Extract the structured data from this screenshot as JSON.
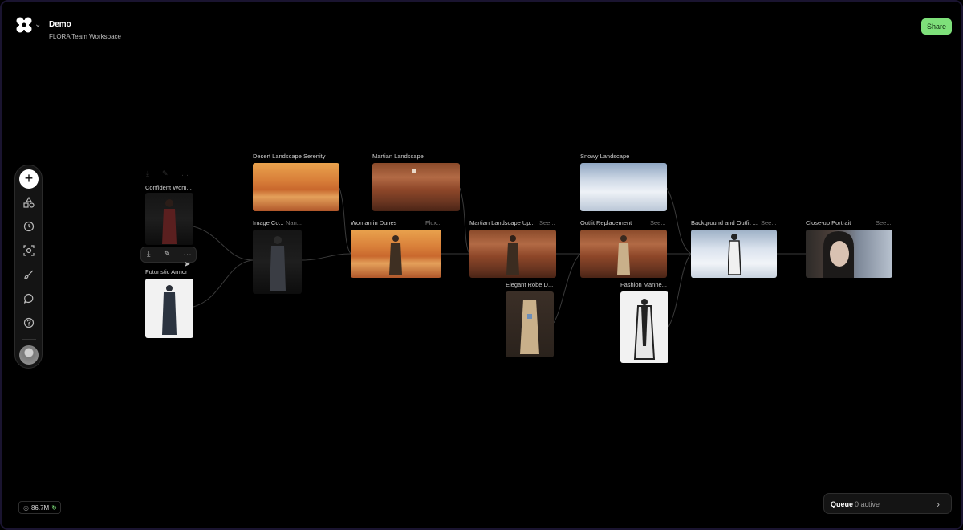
{
  "header": {
    "project_title": "Demo",
    "workspace": "FLORA Team Workspace",
    "share_label": "Share"
  },
  "toolbar": {
    "add_label": "+",
    "icons": [
      "shapes-icon",
      "history-icon",
      "scan-icon",
      "brush-icon",
      "chat-icon",
      "help-icon"
    ]
  },
  "nodes": {
    "confident_woman": {
      "label": "Confident Wom..."
    },
    "futuristic_armor": {
      "label": "Futuristic Armor"
    },
    "desert_landscape": {
      "label": "Desert Landscape Serenity"
    },
    "image_co": {
      "label": "Image Co...",
      "meta": "Nan..."
    },
    "martian_landscape": {
      "label": "Martian Landscape"
    },
    "woman_in_dunes": {
      "label": "Woman in Dunes",
      "meta": "Flux..."
    },
    "martian_landscape_up": {
      "label": "Martian Landscape Up...",
      "meta": "See..."
    },
    "elegant_robe": {
      "label": "Elegant Robe D..."
    },
    "snowy_landscape": {
      "label": "Snowy Landscape"
    },
    "outfit_replacement": {
      "label": "Outfit Replacement",
      "meta": "See..."
    },
    "fashion_mannequin": {
      "label": "Fashion Manne..."
    },
    "background_outfit": {
      "label": "Background and Outfit ...",
      "meta": "See..."
    },
    "closeup_portrait": {
      "label": "Close-up Portrait",
      "meta": "See..."
    }
  },
  "footer": {
    "credits": "86.7M",
    "queue_label": "Queue",
    "queue_status": "0 active"
  },
  "colors": {
    "share_bg": "#7ee07a",
    "canvas_bg": "#000000",
    "edge": "#3a3a3a"
  }
}
